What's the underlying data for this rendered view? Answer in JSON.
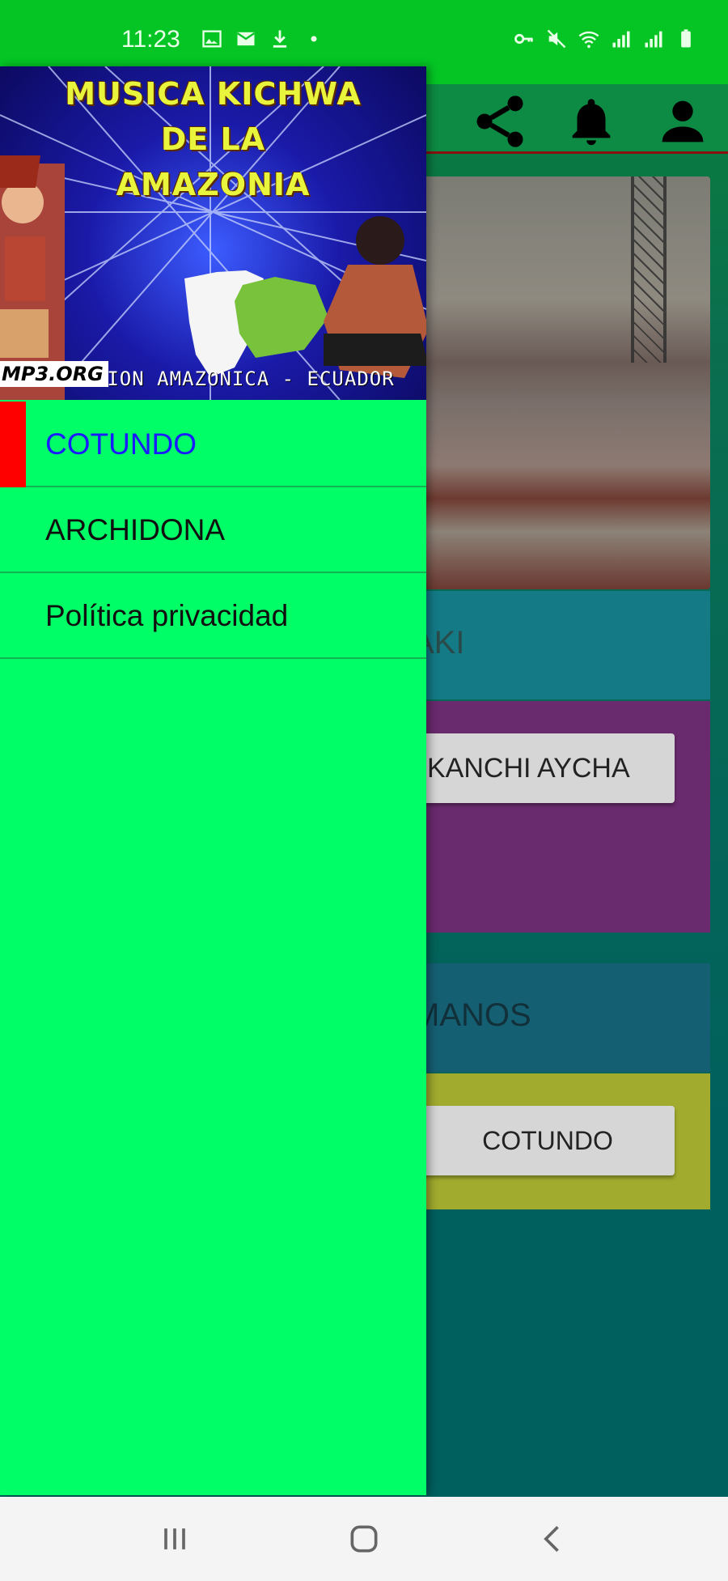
{
  "status_bar": {
    "time": "11:23",
    "left_icons": [
      "image-icon",
      "email-icon",
      "download-icon",
      "dot-icon"
    ],
    "right_icons": [
      "vpn-key-icon",
      "mute-icon",
      "wifi-icon",
      "signal-icon",
      "signal-icon",
      "battery-icon"
    ]
  },
  "drawer": {
    "banner": {
      "title_line1": "MUSICA KICHWA",
      "title_line2": "DE LA",
      "title_line3": "AMAZONIA",
      "caption": "REGION AMAZONICA - ECUADOR",
      "site": "MP3.ORG"
    },
    "menu": [
      {
        "label": "COTUNDO",
        "active": true
      },
      {
        "label": "ARCHIDONA",
        "active": false
      },
      {
        "label": "Política privacidad",
        "active": false
      }
    ]
  },
  "background": {
    "header_icons": [
      "share-icon",
      "bell-icon",
      "account-icon"
    ],
    "section1_label": "AKI",
    "button1_label": "KANCHI AYCHA",
    "section2_label": "MANOS",
    "button2_label": "COTUNDO"
  },
  "nav_bar": {
    "buttons": [
      "recents-icon",
      "home-icon",
      "back-icon"
    ]
  },
  "colors": {
    "status_bar": "#04c524",
    "drawer_bg": "#00fe66",
    "active_indicator": "#ff0000",
    "active_text": "#1b1bff",
    "banner_title": "#e9f53c"
  }
}
